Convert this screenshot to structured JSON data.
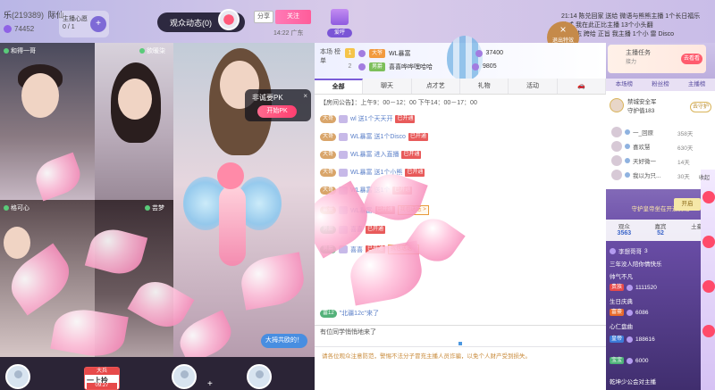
{
  "header": {
    "room_title": "乐",
    "room_number": "(219389)",
    "room_rank": "际仙",
    "hot_value": "74452",
    "host_online_label": "主播心愿",
    "host_online_count": "0 / 1",
    "add_symbol": "+",
    "dynamics_label": "观众动态(0)",
    "share_label": "分享",
    "follow_label": "关注",
    "location_time": "14:22 广东",
    "gift_badge_label": "爱呼",
    "exit_special_label": "退出特效",
    "ticker": [
      "21:14  陈兑回家 送给 微语与熊熊主播 1个长日福乐",
      "欧式 我在此正比主播 13个小头翻",
      "中 陈志 跨给 正旨 我主播 1个小 雷 Disco"
    ]
  },
  "video": {
    "cells": [
      {
        "label": "和得一哥"
      },
      {
        "label": "欲暖柒"
      },
      {
        "label": ""
      },
      {
        "label": "格可心"
      },
      {
        "label": "芸梦"
      }
    ],
    "pk_title": "非诚要PK",
    "pk_button": "开始PK",
    "pk_close": "×",
    "grab_mic": "大拇共欧的！",
    "gift_card_top": "大兵",
    "gift_card_main": "一上拎",
    "gift_card_time": "09:27",
    "plus": "+"
  },
  "ranking": {
    "label": "本场 榜单",
    "rows": [
      {
        "rank": "1",
        "tag": "大爷",
        "name": "WL暴富",
        "value": "37400"
      },
      {
        "rank": "2",
        "tag": "男爵",
        "name": "喜喜哗哗嘿哈哈",
        "value": "9805"
      }
    ]
  },
  "chat": {
    "tabs": [
      "全部",
      "聊天",
      "点才艺",
      "礼物",
      "活动",
      "🚗"
    ],
    "active_tab": "全部",
    "announcement": "【房间公告】：上午9：00－12：00 下午14：00－17：00",
    "lines": [
      {
        "level": "大哥",
        "name": "wl 送1个天天开",
        "tag": "已开通"
      },
      {
        "level": "大哥",
        "name": "WL暴富 送1个Disco",
        "tag": "已开通"
      },
      {
        "level": "大哥",
        "name": "WL暴富 进入直播",
        "tag": "已开通"
      },
      {
        "level": "大哥",
        "name": "WL暴富 送1个小熊",
        "tag": "已开通"
      },
      {
        "level": "大哥",
        "name": "WL暴富 送1个",
        "tag": "已开通"
      },
      {
        "level": "富豪",
        "name": "WL暴富",
        "tag": "已开通",
        "link": "我也送送 >"
      },
      {
        "level": "男爵",
        "name": "喜喜",
        "tag": "已开通"
      },
      {
        "level": "男爵",
        "name": "喜喜",
        "tag": "已开通",
        "link": "我也送送 >"
      }
    ],
    "last_line_level": "富12",
    "last_line_text": "\"北疆12c\"来了",
    "input_value": "有位同学悄悄地来了",
    "notice": "请各位观众注意防范，警惕不法分子冒充主播人员诈骗，以免个人财产受到损失。"
  },
  "right": {
    "task_title": "主播任务",
    "task_sub": "接力",
    "task_button": "去看看",
    "tabs": [
      "本场榜",
      "粉丝榜",
      "主播榜"
    ],
    "guardian_title": "禁城安全军",
    "guardian_count": "守护值183",
    "guard_button": "去守护",
    "guard_rows": [
      {
        "name": "一_回原",
        "days": "358天"
      },
      {
        "name": "喜欢慧",
        "days": "630天"
      },
      {
        "name": "天好微一",
        "days": "14天"
      },
      {
        "name": "我以为只...",
        "days": "30天"
      }
    ],
    "guard_open": "守护皇帝坐在开通资格",
    "audience_label": "观众",
    "audience_count": "3563",
    "guests_label": "嘉宾",
    "guests_count": "52",
    "more_label": "土豪",
    "audience_rows": [
      {
        "badge": "",
        "name": "李想哥哥",
        "value": "3"
      },
      {
        "badge": "",
        "name": "三年没人陪你情快乐",
        "value": ""
      },
      {
        "badge": "",
        "name": "帅气不凡",
        "value": ""
      },
      {
        "badge": "贵族",
        "name": "",
        "value": "1111520"
      },
      {
        "badge": "",
        "name": "生日庆典",
        "value": ""
      },
      {
        "badge": "富豪",
        "name": "",
        "value": "6086"
      },
      {
        "badge": "",
        "name": "心仁盘曲",
        "value": ""
      },
      {
        "badge": "皇帝",
        "name": "",
        "value": "188616"
      },
      {
        "badge": "宝宝",
        "name": "",
        "value": "6000"
      },
      {
        "badge": "",
        "name": "乾坤少公会对主播",
        "value": ""
      }
    ],
    "start_button": "开启",
    "side_tag": "收起"
  },
  "colors": {
    "accent": "#7a5cd8",
    "follow": "#ff5c9a",
    "chat_name": "#5a7fc8",
    "notice": "#c88a3a"
  }
}
